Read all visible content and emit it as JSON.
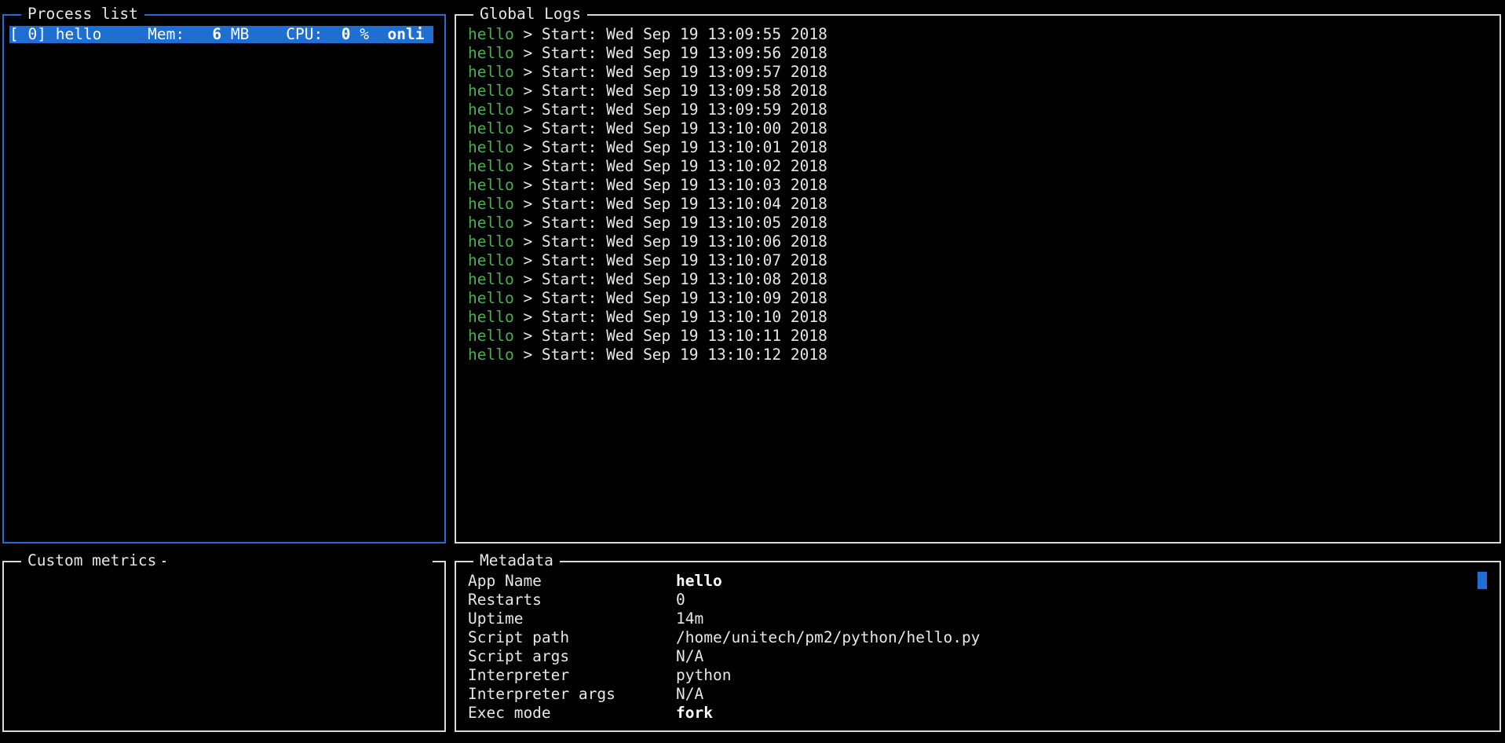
{
  "process_panel": {
    "title": "Process list",
    "row": {
      "index": "[ 0]",
      "name": "hello",
      "mem_label": "Mem:",
      "mem_value": "6",
      "mem_unit": "MB",
      "cpu_label": "CPU:",
      "cpu_value": "0",
      "cpu_unit": "%",
      "status": "onli"
    }
  },
  "logs_panel": {
    "title": "Global Logs",
    "lines": [
      {
        "app": "hello",
        "text": " > Start: Wed Sep 19 13:09:55 2018"
      },
      {
        "app": "hello",
        "text": " > Start: Wed Sep 19 13:09:56 2018"
      },
      {
        "app": "hello",
        "text": " > Start: Wed Sep 19 13:09:57 2018"
      },
      {
        "app": "hello",
        "text": " > Start: Wed Sep 19 13:09:58 2018"
      },
      {
        "app": "hello",
        "text": " > Start: Wed Sep 19 13:09:59 2018"
      },
      {
        "app": "hello",
        "text": " > Start: Wed Sep 19 13:10:00 2018"
      },
      {
        "app": "hello",
        "text": " > Start: Wed Sep 19 13:10:01 2018"
      },
      {
        "app": "hello",
        "text": " > Start: Wed Sep 19 13:10:02 2018"
      },
      {
        "app": "hello",
        "text": " > Start: Wed Sep 19 13:10:03 2018"
      },
      {
        "app": "hello",
        "text": " > Start: Wed Sep 19 13:10:04 2018"
      },
      {
        "app": "hello",
        "text": " > Start: Wed Sep 19 13:10:05 2018"
      },
      {
        "app": "hello",
        "text": " > Start: Wed Sep 19 13:10:06 2018"
      },
      {
        "app": "hello",
        "text": " > Start: Wed Sep 19 13:10:07 2018"
      },
      {
        "app": "hello",
        "text": " > Start: Wed Sep 19 13:10:08 2018"
      },
      {
        "app": "hello",
        "text": " > Start: Wed Sep 19 13:10:09 2018"
      },
      {
        "app": "hello",
        "text": " > Start: Wed Sep 19 13:10:10 2018"
      },
      {
        "app": "hello",
        "text": " > Start: Wed Sep 19 13:10:11 2018"
      },
      {
        "app": "hello",
        "text": " > Start: Wed Sep 19 13:10:12 2018"
      }
    ]
  },
  "metrics_panel": {
    "title": "Custom metrics"
  },
  "meta_panel": {
    "title": "Metadata",
    "rows": [
      {
        "key": "App Name",
        "value": "hello",
        "bold": true
      },
      {
        "key": "Restarts",
        "value": "0",
        "bold": false
      },
      {
        "key": "Uptime",
        "value": "14m",
        "bold": false
      },
      {
        "key": "Script path",
        "value": "/home/unitech/pm2/python/hello.py",
        "bold": false
      },
      {
        "key": "Script args",
        "value": "N/A",
        "bold": false
      },
      {
        "key": "Interpreter",
        "value": "python",
        "bold": false
      },
      {
        "key": "Interpreter args",
        "value": "N/A",
        "bold": false
      },
      {
        "key": "Exec mode",
        "value": "fork",
        "bold": true
      }
    ]
  },
  "colors": {
    "selection": "#1e6fcf",
    "focus_border": "#2a6bd0",
    "log_app": "#4caf50",
    "border": "#d9d9d9"
  }
}
